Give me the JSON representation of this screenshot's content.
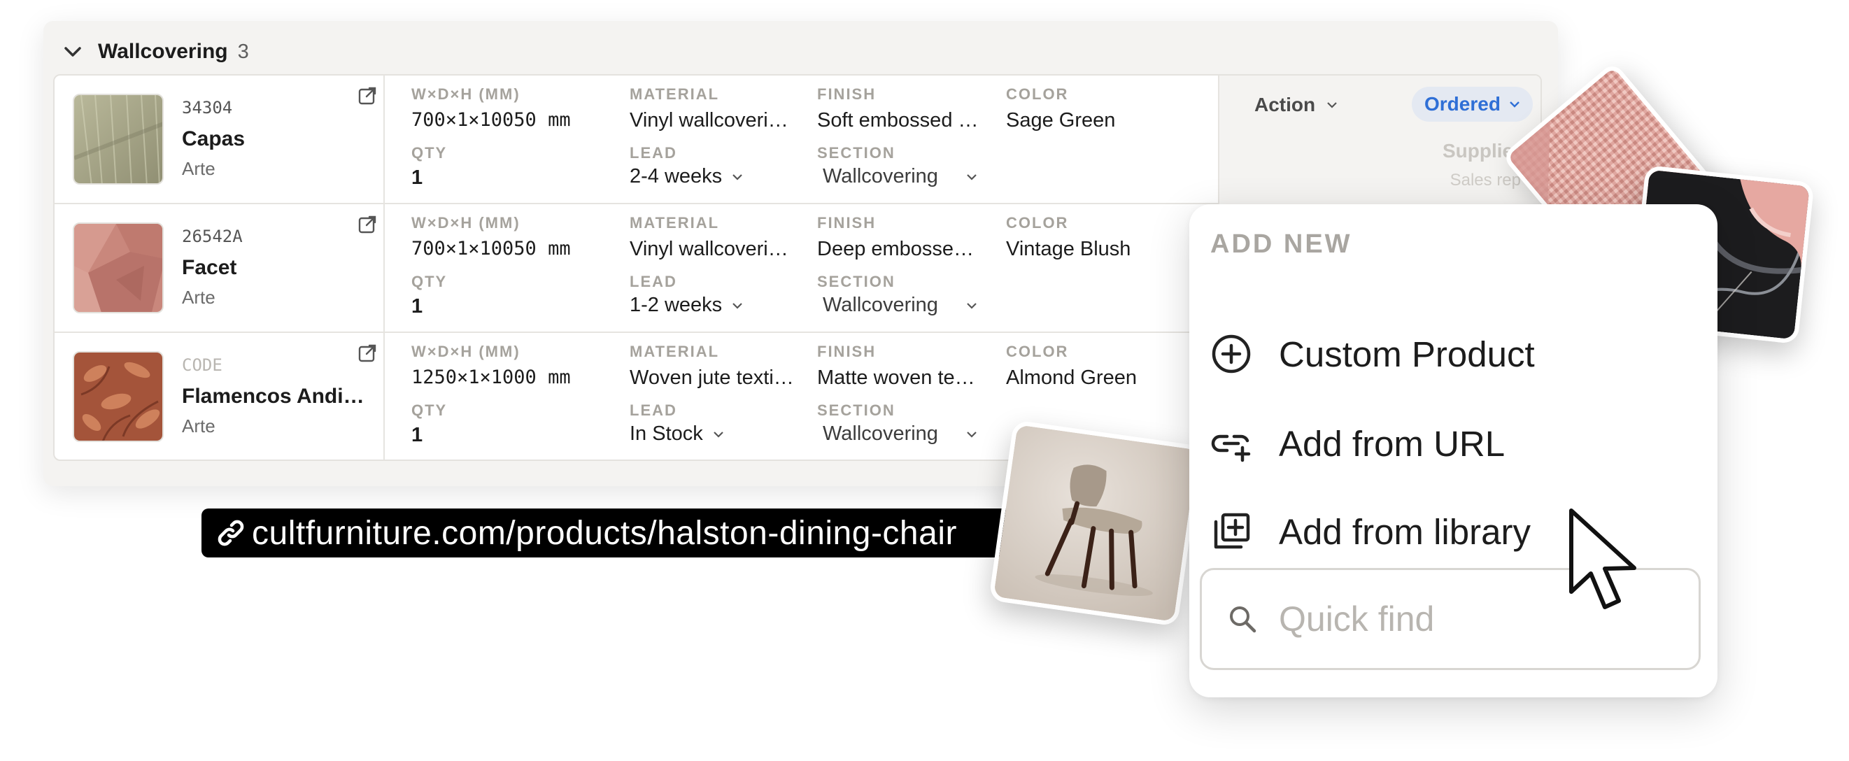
{
  "group": {
    "title": "Wallcovering",
    "count": "3"
  },
  "column_labels": {
    "dims": "W×D×H (MM)",
    "qty": "QTY",
    "material": "MATERIAL",
    "lead": "LEAD",
    "finish": "FINISH",
    "section": "SECTION",
    "color": "COLOR"
  },
  "rows": [
    {
      "code": "34304",
      "name": "Capas",
      "brand": "Arte",
      "dims": "700×1×10050 mm",
      "qty": "1",
      "material": "Vinyl wallcoveri…",
      "lead": "2-4 weeks",
      "finish": "Soft embossed …",
      "section": "Wallcovering",
      "color": "Sage Green"
    },
    {
      "code": "26542A",
      "name": "Facet",
      "brand": "Arte",
      "dims": "700×1×10050 mm",
      "qty": "1",
      "material": "Vinyl wallcoveri…",
      "lead": "1-2 weeks",
      "finish": "Deep embosse…",
      "section": "Wallcovering",
      "color": "Vintage Blush"
    },
    {
      "code": "CODE",
      "name": "Flamencos Andi…",
      "brand": "Arte",
      "dims": "1250×1×1000 mm",
      "qty": "1",
      "material": "Woven jute texti…",
      "lead": "In Stock",
      "finish": "Matte woven te…",
      "section": "Wallcovering",
      "color": "Almond Green"
    }
  ],
  "status": {
    "action": "Action",
    "ordered": "Ordered",
    "supplier": "Supplier",
    "sales_rep": "Sales rep"
  },
  "url": "cultfurniture.com/products/halston-dining-chair",
  "menu": {
    "heading": "ADD NEW",
    "items": [
      "Custom Product",
      "Add from URL",
      "Add from library"
    ],
    "search_placeholder": "Quick find"
  },
  "colors": {
    "accent_blue": "#2f6fd6",
    "panel_bg": "#f4f3f1",
    "url_bar_bg": "#000000"
  },
  "icons": [
    "chevron-down-icon",
    "external-link-icon",
    "link-icon",
    "plus-circle-icon",
    "link-plus-icon",
    "library-add-icon",
    "search-icon",
    "cursor-icon"
  ]
}
